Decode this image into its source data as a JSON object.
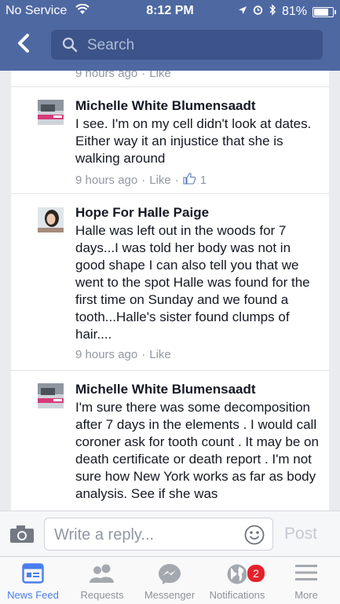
{
  "status_bar": {
    "carrier": "No Service",
    "time": "8:12 PM",
    "battery": "81%",
    "battery_level": 0.81
  },
  "header": {
    "search_placeholder": "Search"
  },
  "comments": [
    {
      "author": "",
      "text": "",
      "time": "9 hours ago",
      "like_label": "Like"
    },
    {
      "author": "Michelle White Blumensaadt",
      "text": "I see. I'm on my cell didn't look at dates. Either way it an injustice that she is walking around",
      "time": "9 hours ago",
      "like_label": "Like",
      "like_count": "1"
    },
    {
      "author": "Hope For Halle Paige",
      "text": "Halle was left out in the woods for 7 days...I was told her body was not in good shape I can also tell you that we went to the spot Halle was found for the first time on Sunday and we found a tooth...Halle's sister found clumps of hair....",
      "time": "9 hours ago",
      "like_label": "Like"
    },
    {
      "author": "Michelle White Blumensaadt",
      "text": "I'm sure there was some decomposition after 7 days in the elements . I would call coroner ask for tooth count . It may be on death certificate  or death report . I'm not sure how New York works as far as body analysis. See if she was"
    }
  ],
  "reply_bar": {
    "placeholder": "Write a reply...",
    "post_label": "Post"
  },
  "tabs": [
    {
      "label": "News Feed",
      "icon": "news-feed-icon",
      "active": true
    },
    {
      "label": "Requests",
      "icon": "friend-requests-icon"
    },
    {
      "label": "Messenger",
      "icon": "messenger-icon"
    },
    {
      "label": "Notifications",
      "icon": "globe-icon",
      "badge": "2"
    },
    {
      "label": "More",
      "icon": "menu-icon"
    }
  ],
  "colors": {
    "brand": "#4e69a2",
    "active_tab": "#4a7ef0",
    "badge": "#e4222b"
  }
}
